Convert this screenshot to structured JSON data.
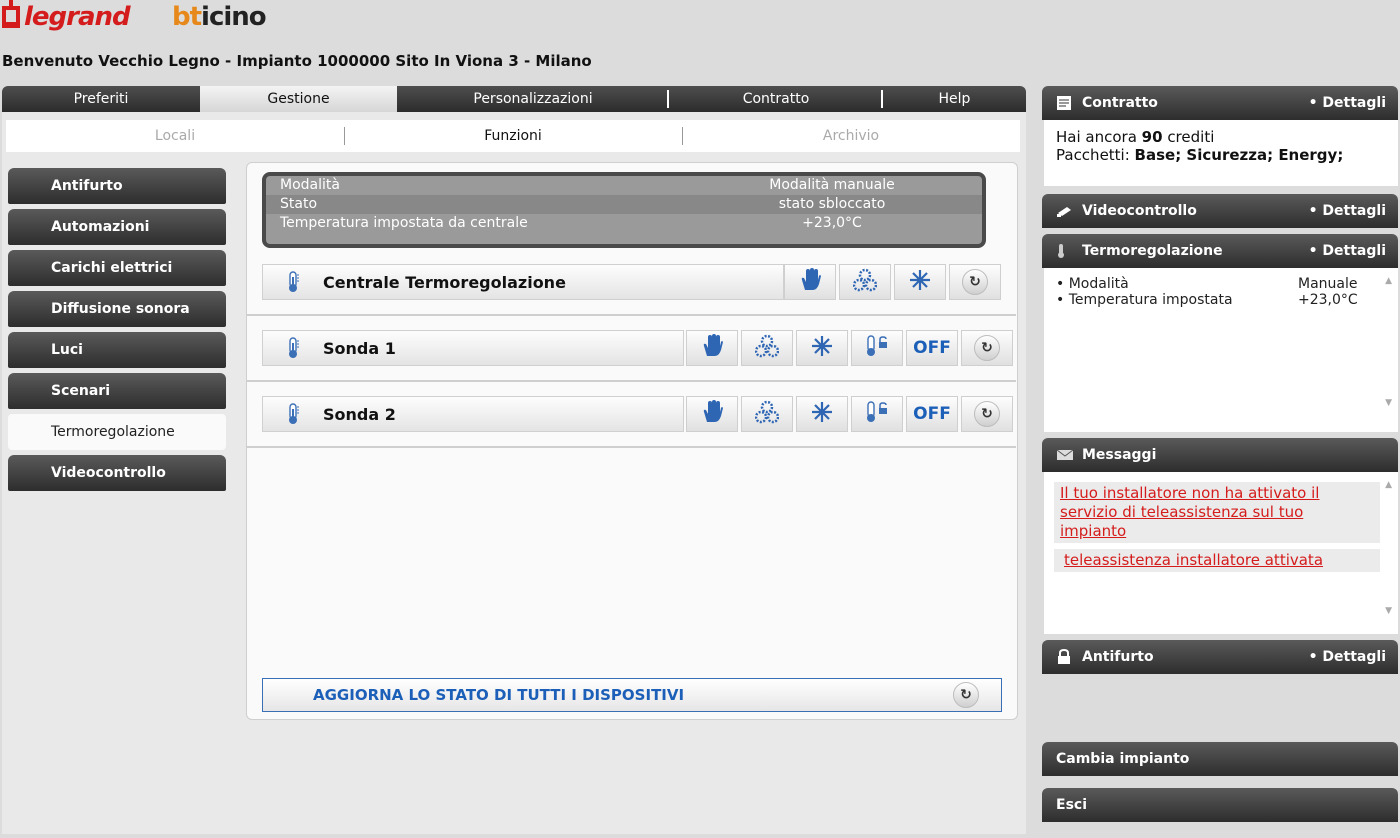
{
  "header": {
    "logo_legrand": "legrand",
    "logo_bticino_a": "bt",
    "logo_bticino_b": "icino",
    "welcome": "Benvenuto Vecchio Legno - Impianto 1000000 Sito In Viona 3 - Milano"
  },
  "main_tabs": [
    "Preferiti",
    "Gestione",
    "Personalizzazioni",
    "Contratto",
    "Help"
  ],
  "active_main_tab": "Gestione",
  "sub_tabs": [
    "Locali",
    "Funzioni",
    "Archivio"
  ],
  "active_sub_tab": "Funzioni",
  "nav": {
    "items": [
      "Antifurto",
      "Automazioni",
      "Carichi elettrici",
      "Diffusione sonora",
      "Luci",
      "Scenari",
      "Termoregolazione",
      "Videocontrollo"
    ],
    "active": "Termoregolazione"
  },
  "status": {
    "rows": [
      {
        "label": "Modalità",
        "value": "Modalità manuale"
      },
      {
        "label": "Stato",
        "value": "stato sbloccato"
      },
      {
        "label": "Temperatura impostata da centrale",
        "value": "+23,0°C"
      }
    ]
  },
  "devices": [
    {
      "name": "Centrale Termoregolazione"
    },
    {
      "name": "Sonda 1",
      "off_label": "OFF"
    },
    {
      "name": "Sonda 2",
      "off_label": "OFF"
    }
  ],
  "update_all_label": "AGGIORNA LO STATO DI TUTTI I DISPOSITIVI",
  "sidebar": {
    "dettagli": "• Dettagli",
    "contratto": {
      "title": "Contratto",
      "line1_pre": "Hai ancora ",
      "credits": "90",
      "line1_post": " crediti",
      "line2_pre": "Pacchetti: ",
      "packages": "Base; Sicurezza; Energy;"
    },
    "videocontrollo": {
      "title": "Videocontrollo"
    },
    "termoregolazione": {
      "title": "Termoregolazione",
      "rows": [
        {
          "label": "• Modalità",
          "value": "Manuale"
        },
        {
          "label": "• Temperatura impostata",
          "value": "+23,0°C"
        }
      ]
    },
    "messaggi": {
      "title": "Messaggi",
      "msg1": "Il tuo installatore non ha attivato il servizio di teleassistenza sul tuo impianto",
      "msg2": "teleassistenza installatore attivata"
    },
    "antifurto": {
      "title": "Antifurto"
    },
    "cambia_impianto": "Cambia impianto",
    "esci": "Esci"
  },
  "colors": {
    "accent_red": "#d51c1c",
    "accent_blue": "#1c5fb8",
    "bticino_orange": "#e6881a"
  }
}
